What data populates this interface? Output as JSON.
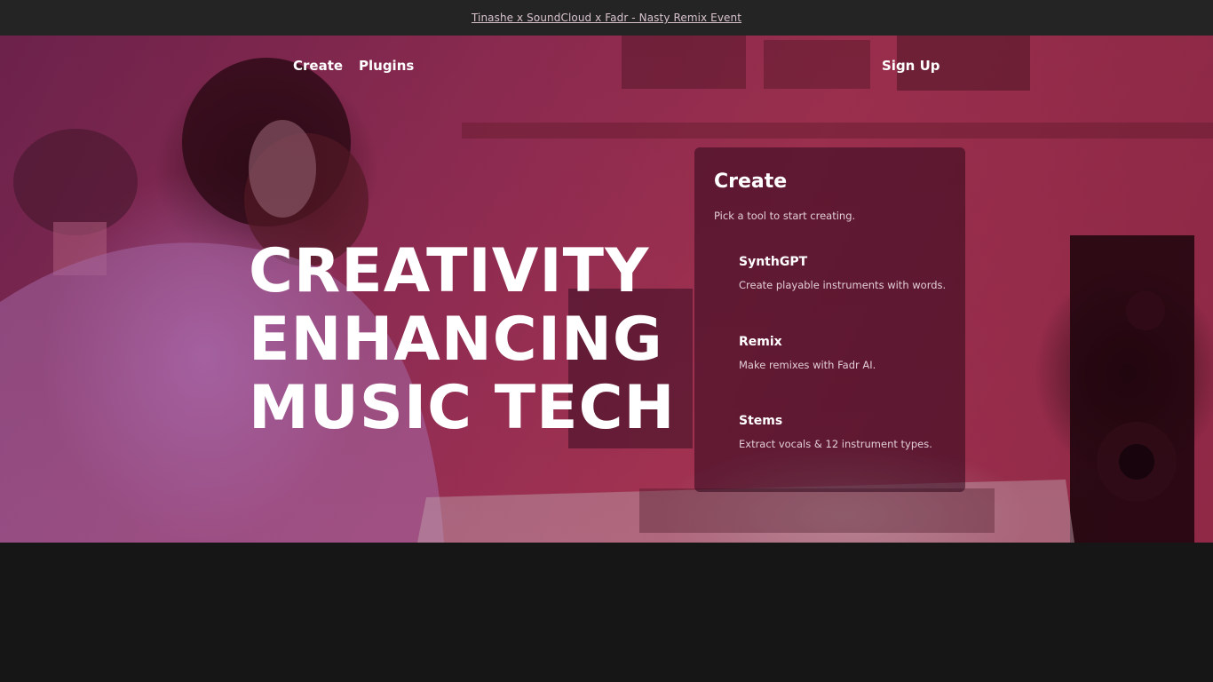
{
  "announcement": {
    "text": "Tinashe x SoundCloud x Fadr - Nasty Remix Event"
  },
  "nav": {
    "create_label": "Create",
    "plugins_label": "Plugins",
    "signup_label": "Sign Up"
  },
  "hero": {
    "headline_lines": [
      "CREATIVITY",
      "ENHANCING",
      "MUSIC TECH"
    ]
  },
  "create_panel": {
    "title": "Create",
    "subtitle": "Pick a tool to start creating.",
    "tools": [
      {
        "name": "SynthGPT",
        "description": "Create playable instruments with words."
      },
      {
        "name": "Remix",
        "description": "Make remixes with Fadr AI."
      },
      {
        "name": "Stems",
        "description": "Extract vocals & 12 instrument types."
      }
    ]
  },
  "colors": {
    "page_background": "#161616",
    "announcement_bar": "#242424",
    "hero_accent": "#b73a5c",
    "text": "#ffffff"
  }
}
